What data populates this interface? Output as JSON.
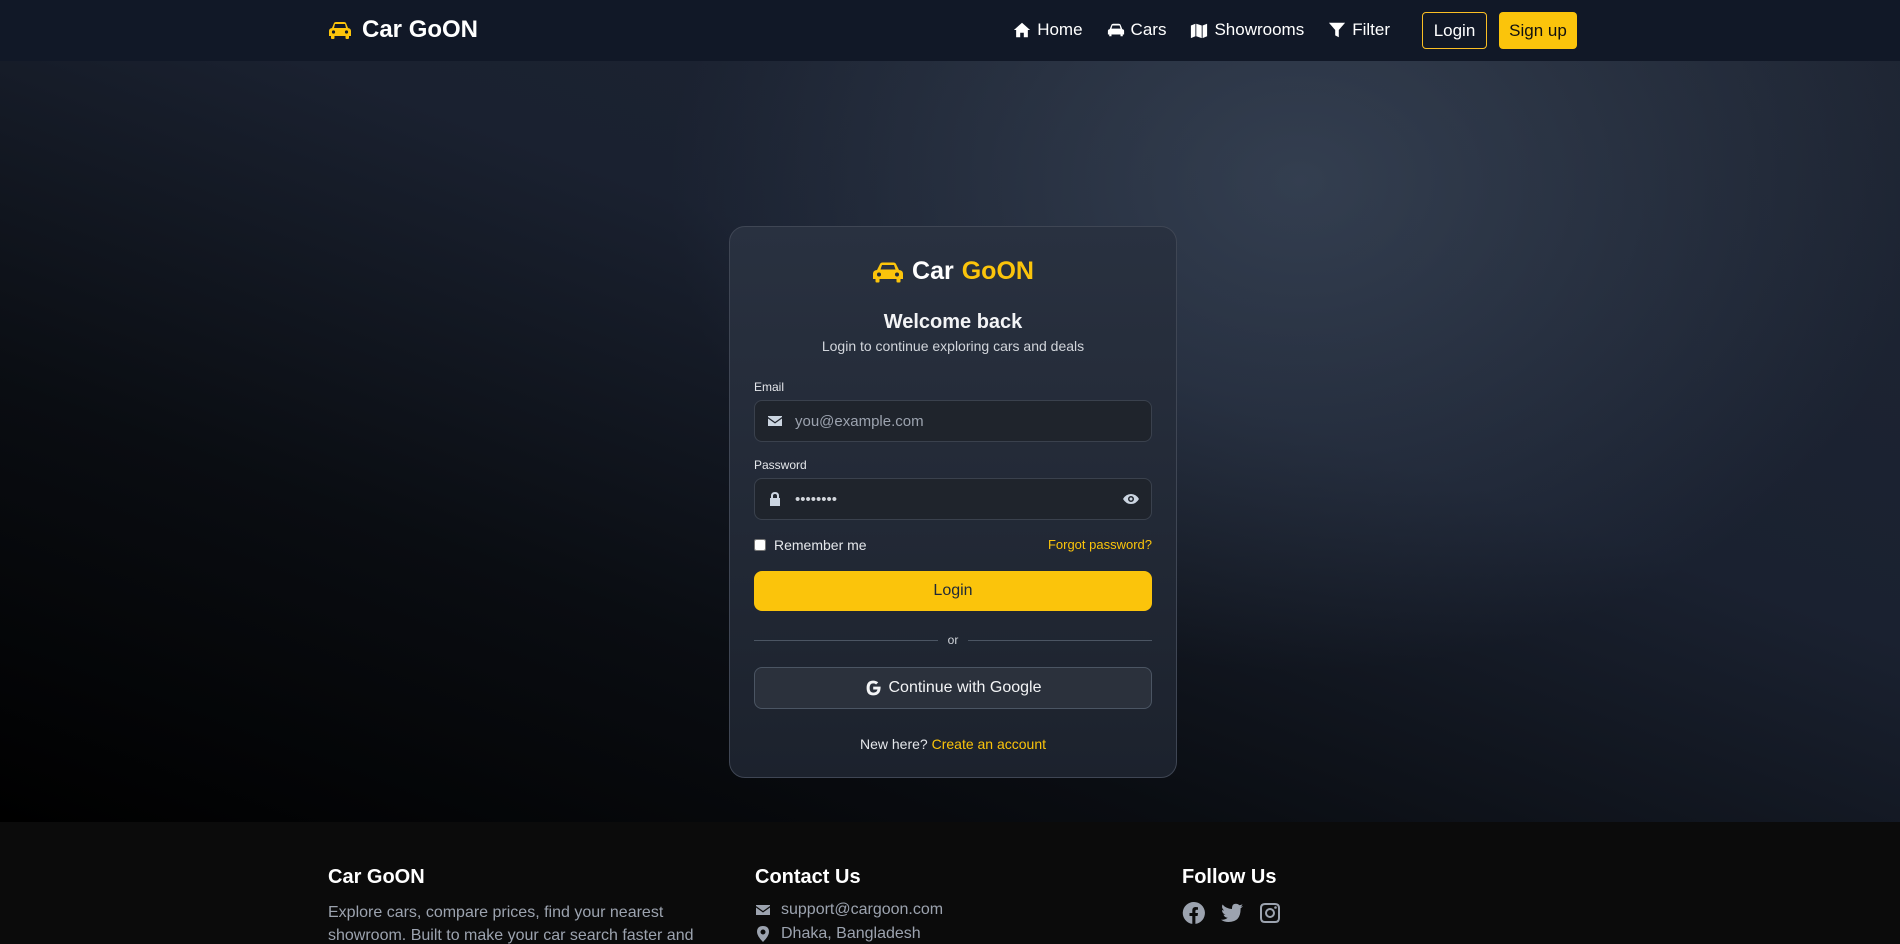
{
  "navbar": {
    "brand": "Car GoON",
    "links": [
      {
        "label": "Home",
        "icon": "home-icon"
      },
      {
        "label": "Cars",
        "icon": "car-icon"
      },
      {
        "label": "Showrooms",
        "icon": "map-icon"
      },
      {
        "label": "Filter",
        "icon": "filter-icon"
      }
    ],
    "login_label": "Login",
    "signup_label": "Sign up"
  },
  "card": {
    "brand_white": "Car",
    "brand_yellow": "GoON",
    "title": "Welcome back",
    "subtitle": "Login to continue exploring cars and deals",
    "email": {
      "label": "Email",
      "placeholder": "you@example.com",
      "value": ""
    },
    "password": {
      "label": "Password",
      "value": "••••••••"
    },
    "remember_label": "Remember me",
    "forgot_label": "Forgot password?",
    "login_label": "Login",
    "divider_label": "or",
    "google_label": "Continue with Google",
    "new_here": "New here?",
    "create_account": "Create an account"
  },
  "footer": {
    "brand": "Car GoON",
    "description": "Explore cars, compare prices, find your nearest showroom. Built to make your car search faster and",
    "contact_title": "Contact Us",
    "contact_email": "support@cargoon.com",
    "contact_location": "Dhaka, Bangladesh",
    "follow_title": "Follow Us",
    "socials": [
      "facebook-icon",
      "twitter-icon",
      "instagram-icon"
    ]
  },
  "colors": {
    "accent": "#fbc40b",
    "navbar_bg": "#111827",
    "card_bg": "#252c38"
  }
}
